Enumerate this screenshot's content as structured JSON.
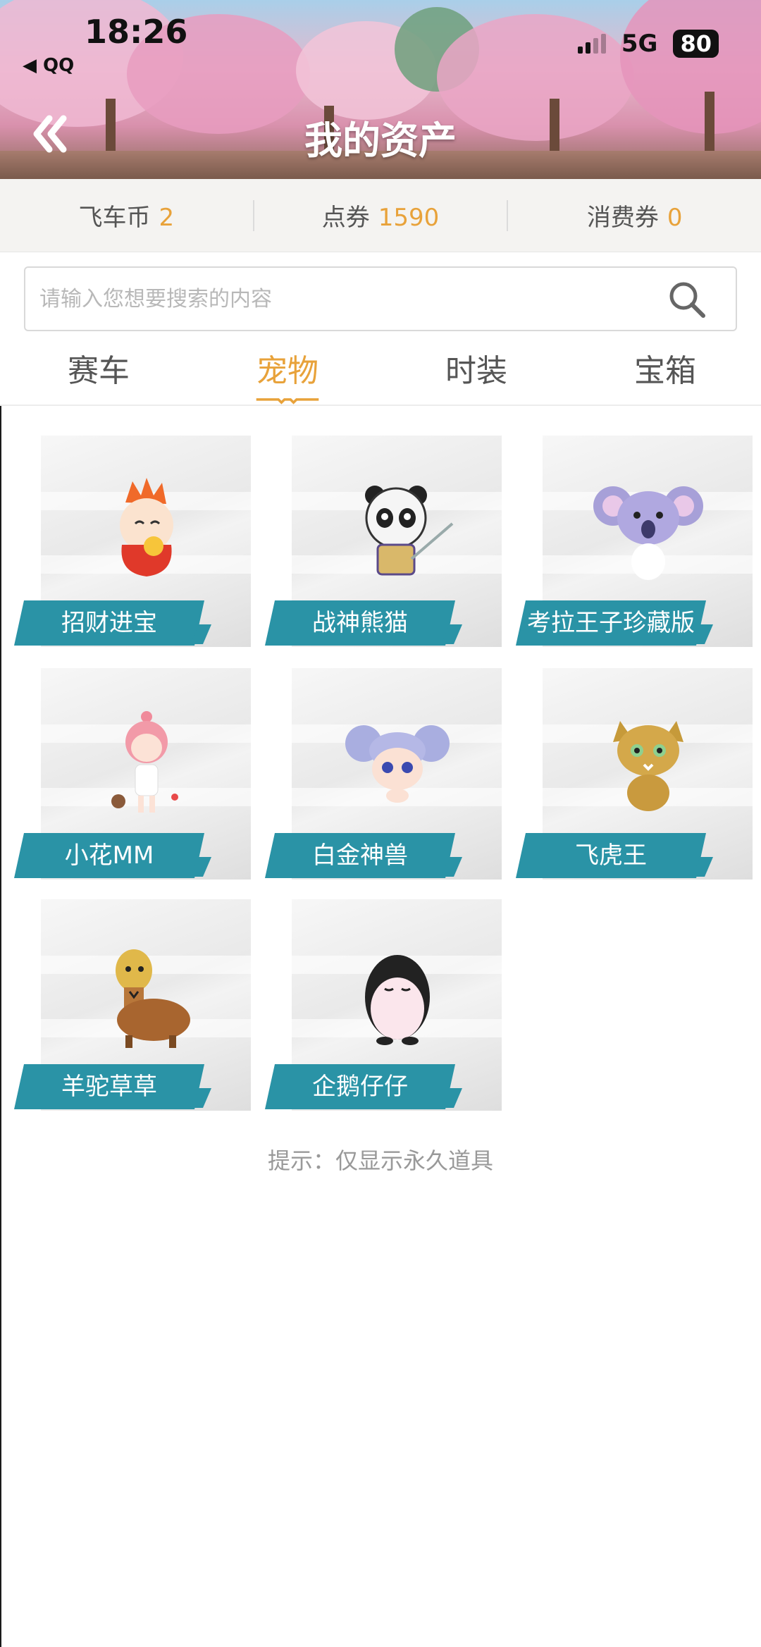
{
  "status_bar": {
    "time": "18:26",
    "back_app": "◀ QQ",
    "network": "5G",
    "battery": "80"
  },
  "header": {
    "title": "我的资产"
  },
  "currencies": [
    {
      "label": "飞车币",
      "value": "2"
    },
    {
      "label": "点券",
      "value": "1590"
    },
    {
      "label": "消费券",
      "value": "0"
    }
  ],
  "search": {
    "placeholder": "请输入您想要搜索的内容",
    "value": ""
  },
  "tabs": [
    {
      "label": "赛车",
      "active": false
    },
    {
      "label": "宠物",
      "active": true
    },
    {
      "label": "时装",
      "active": false
    },
    {
      "label": "宝箱",
      "active": false
    }
  ],
  "colors": {
    "accent": "#e8a23a",
    "label_band": "#2a93a6"
  },
  "pets": [
    {
      "name": "招财进宝",
      "icon": "fire-dragon-pet-icon"
    },
    {
      "name": "战神熊猫",
      "icon": "panda-warrior-pet-icon"
    },
    {
      "name": "考拉王子珍藏版",
      "icon": "koala-prince-pet-icon"
    },
    {
      "name": "小花MM",
      "icon": "flower-girl-pet-icon"
    },
    {
      "name": "白金神兽",
      "icon": "platinum-beast-pet-icon"
    },
    {
      "name": "飞虎王",
      "icon": "flying-tiger-pet-icon"
    },
    {
      "name": "羊驼草草",
      "icon": "alpaca-pet-icon"
    },
    {
      "name": "企鹅仔仔",
      "icon": "penguin-pet-icon"
    }
  ],
  "hint": "提示：仅显示永久道具"
}
